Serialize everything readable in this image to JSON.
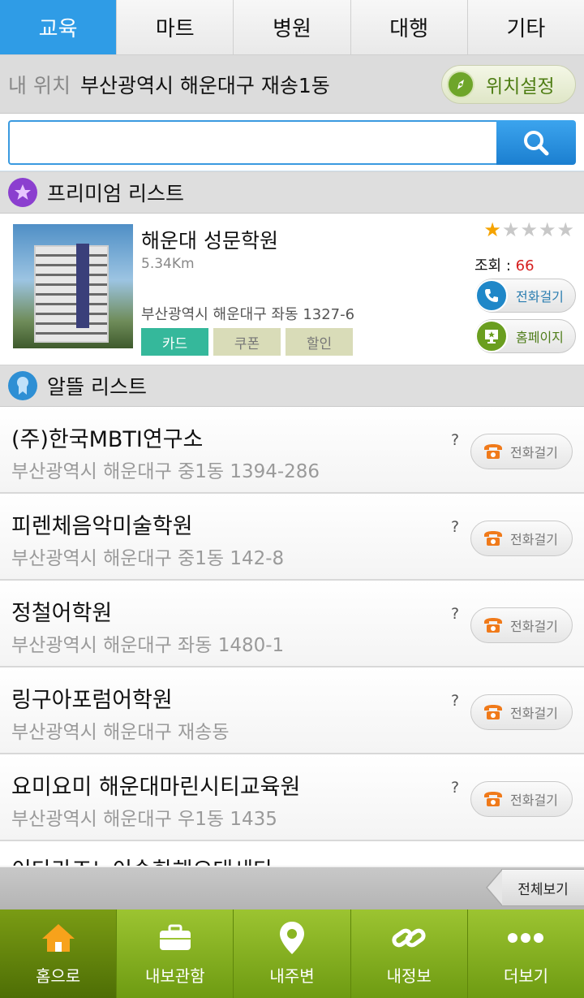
{
  "tabs": [
    "교육",
    "마트",
    "병원",
    "대행",
    "기타"
  ],
  "location": {
    "label": "내 위치",
    "value": "부산광역시 해운대구 재송1동",
    "button": "위치설정"
  },
  "search": {
    "placeholder": "",
    "value": ""
  },
  "premium": {
    "section_title": "프리미엄 리스트",
    "name": "해운대 성문학원",
    "distance": "5.34Km",
    "address": "부산광역시 해운대구 좌동 1327-6",
    "badges": [
      "카드",
      "쿠폰",
      "할인"
    ],
    "rating": 1,
    "rating_max": 5,
    "views_label": "조회 : ",
    "views": "66",
    "call_label": "전화걸기",
    "home_label": "홈페이지"
  },
  "list": {
    "section_title": "알뜰 리스트",
    "call_label": "전화걸기",
    "question": "?",
    "items": [
      {
        "name": "(주)한국MBTI연구소",
        "address": "부산광역시 해운대구 중1동 1394-286"
      },
      {
        "name": "피렌체음악미술학원",
        "address": "부산광역시 해운대구 중1동 142-8"
      },
      {
        "name": "정철어학원",
        "address": "부산광역시 해운대구 좌동 1480-1"
      },
      {
        "name": "링구아포럼어학원",
        "address": "부산광역시 해운대구 재송동"
      },
      {
        "name": "요미요미 해운대마린시티교육원",
        "address": "부산광역시 해운대구 우1동 1435"
      }
    ],
    "partial_item": "이다라즈뇨이솟한해오대세다"
  },
  "view_all": "전체보기",
  "nav": [
    {
      "label": "홈으로",
      "icon": "home-icon"
    },
    {
      "label": "내보관함",
      "icon": "briefcase-icon"
    },
    {
      "label": "내주변",
      "icon": "location-pin-icon"
    },
    {
      "label": "내정보",
      "icon": "link-icon"
    },
    {
      "label": "더보기",
      "icon": "more-icon"
    }
  ],
  "colors": {
    "tab_active": "#2f9ce6",
    "nav_green": "#8ab522",
    "views_red": "#d62020",
    "card_badge": "#35b89b"
  }
}
